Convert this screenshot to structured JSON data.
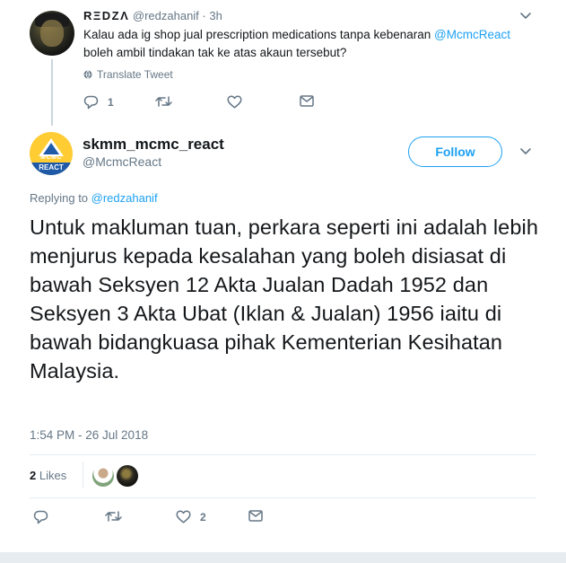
{
  "parent_tweet": {
    "display_name": "RΞDZΛ",
    "handle": "@redzahanif",
    "separator": "·",
    "time": "3h",
    "text_before_mention": "Kalau ada ig shop jual prescription medications tanpa kebenaran ",
    "mention": "@McmcReact",
    "text_after_mention": " boleh ambil tindakan tak ke atas akaun tersebut?",
    "translate_label": "Translate Tweet",
    "reply_count": "1",
    "retweet_count": "",
    "like_count": ""
  },
  "main_tweet": {
    "display_name": "skmm_mcmc_react",
    "handle": "@McmcReact",
    "follow_label": "Follow",
    "replying_label": "Replying to ",
    "replying_mention": "@redzahanif",
    "text": "Untuk makluman tuan, perkara seperti ini adalah lebih menjurus kepada kesalahan yang boleh disiasat di bawah Seksyen 12 Akta Jualan Dadah 1952 dan Seksyen 3 Akta Ubat (Iklan & Jualan) 1956 iaitu di bawah bidangkuasa pihak Kementerian Kesihatan Malaysia.",
    "timestamp": "1:54 PM - 26 Jul 2018",
    "likes_count": "2",
    "likes_label": " Likes",
    "avatar_text_top": "MCMC",
    "avatar_text_bottom": "REACT",
    "reply_count": "",
    "retweet_count": "",
    "like_count": "2"
  },
  "icons": {
    "reply": "reply-icon",
    "retweet": "retweet-icon",
    "like": "heart-icon",
    "dm": "envelope-icon",
    "caret": "chevron-down-icon",
    "translate": "globe-icon"
  },
  "colors": {
    "accent": "#1da1f2",
    "secondary_text": "#657786",
    "primary_text": "#14171a",
    "divider": "#e6ecf0",
    "avatar_yellow": "#ffcc33",
    "avatar_blue": "#1e5aa8"
  }
}
